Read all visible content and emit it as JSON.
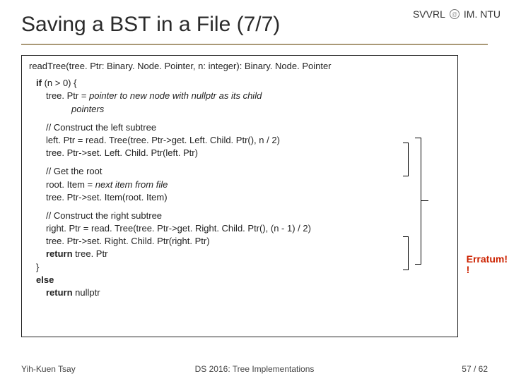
{
  "header": {
    "left": "SVRL",
    "right": "IM. NTU",
    "svvrl": "SVVRL"
  },
  "title": "Saving a BST in a File (7/7)",
  "code": {
    "fn_sig": "readTree(tree. Ptr: Binary. Node. Pointer, n: integer): Binary. Node. Pointer",
    "if_kw": "if",
    "if_cond": " (n > 0) {",
    "l1a": "tree. Ptr = ",
    "l1b": "pointer to new node with nullptr as its child",
    "l1c": "pointers",
    "c1": "// Construct the left subtree",
    "l2": "left. Ptr = read. Tree(tree. Ptr->get. Left. Child. Ptr(), n / 2)",
    "l3": "tree. Ptr->set. Left. Child. Ptr(left. Ptr)",
    "c2": "// Get the root",
    "l4a": "root. Item = ",
    "l4b": "next item from file",
    "l5": "tree. Ptr->set. Item(root. Item)",
    "c3": "// Construct the right subtree",
    "l6": "right. Ptr = read. Tree(tree. Ptr->get. Right. Child. Ptr(), (n - 1) / 2)",
    "l7": "tree. Ptr->set. Right. Child. Ptr(right. Ptr)",
    "ret_kw": "return",
    "ret1": " tree. Ptr",
    "close": "}",
    "else_kw": "else",
    "ret2_kw": "return",
    "ret2": " nullptr"
  },
  "erratum": {
    "line1": "Erratum!",
    "line2": "!"
  },
  "footer": {
    "left": "Yih-Kuen Tsay",
    "center": "DS 2016: Tree Implementations",
    "right": "57 / 62"
  }
}
